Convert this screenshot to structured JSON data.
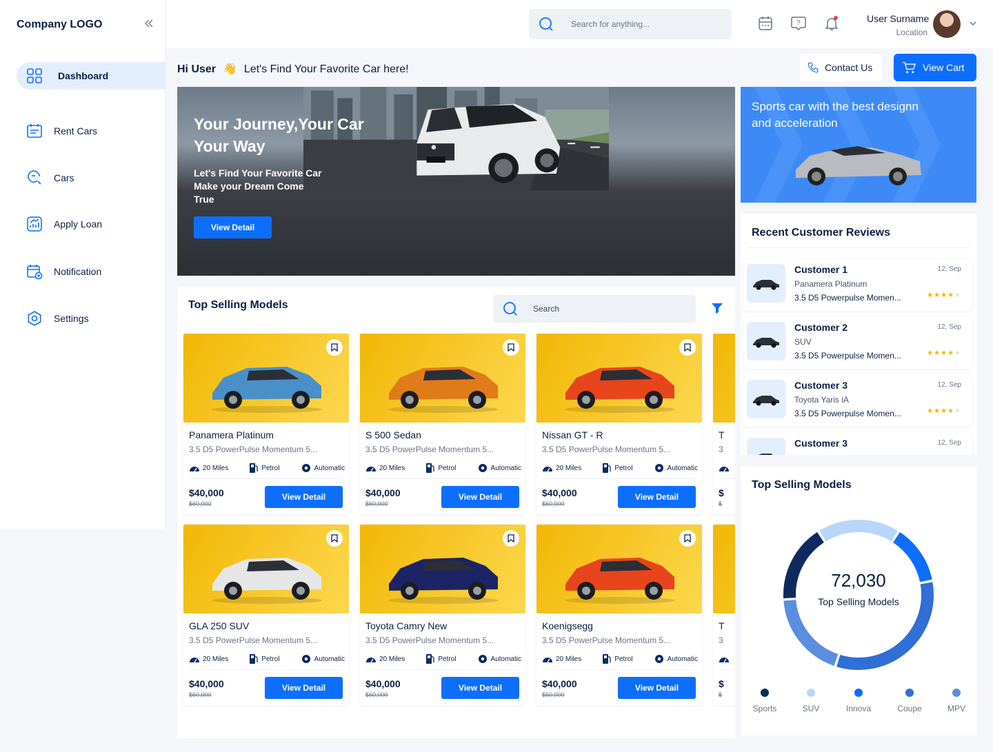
{
  "sidebar": {
    "logo": "Company LOGO",
    "items": [
      {
        "label": "Dashboard"
      },
      {
        "label": "Rent Cars"
      },
      {
        "label": "Cars"
      },
      {
        "label": "Apply Loan"
      },
      {
        "label": "Notification"
      },
      {
        "label": "Settings"
      }
    ]
  },
  "header": {
    "search_placeholder": "Search for anything...",
    "user_name": "User Surname",
    "user_location": "Location"
  },
  "greeting": {
    "hi": "Hi User",
    "emoji": "👋",
    "text": "Let's Find Your Favorite Car here!",
    "contact_label": "Contact Us",
    "cart_label": "View Cart"
  },
  "hero": {
    "title": "Your Journey,Your Car Your Way",
    "subtitle": "Let's Find Your Favorite Car Make your Dream Come True",
    "button": "View Detail"
  },
  "promo": {
    "text": "Sports car with the best designn and acceleration"
  },
  "top_selling": {
    "title": "Top Selling Models",
    "search_placeholder": "Search",
    "cards": [
      {
        "name": "Panamera Platinum",
        "desc": "3.5 D5 PowerPulse Momentum 5...",
        "miles": "20 Miles",
        "fuel": "Petrol",
        "trans": "Automatic",
        "price": "$40,000",
        "old_price": "$60,000",
        "button": "View Detail",
        "car_color": "#4a90c8"
      },
      {
        "name": "S 500 Sedan",
        "desc": "3.5 D5 PowerPulse Momentum 5...",
        "miles": "20 Miles",
        "fuel": "Petrol",
        "trans": "Automatic",
        "price": "$40,000",
        "old_price": "$60,000",
        "button": "View Detail",
        "car_color": "#e07b1a"
      },
      {
        "name": "Nissan GT - R",
        "desc": "3.5 D5 PowerPulse Momentum 5...",
        "miles": "20 Miles",
        "fuel": "Petrol",
        "trans": "Automatic",
        "price": "$40,000",
        "old_price": "$60,000",
        "button": "View Detail",
        "car_color": "#e8451c"
      },
      {
        "name": "T",
        "desc": "3",
        "miles": "",
        "fuel": "",
        "trans": "",
        "price": "$",
        "old_price": "$",
        "button": "",
        "car_color": "#f2b705"
      },
      {
        "name": "GLA 250 SUV",
        "desc": "3.5 D5 PowerPulse Momentum 5...",
        "miles": "20 Miles",
        "fuel": "Petrol",
        "trans": "Automatic",
        "price": "$40,000",
        "old_price": "$60,000",
        "button": "View Detail",
        "car_color": "#e6e6e6"
      },
      {
        "name": "Toyota Camry New",
        "desc": "3.5 D5 PowerPulse Momentum 5...",
        "miles": "20 Miles",
        "fuel": "Petrol",
        "trans": "Automatic",
        "price": "$40,000",
        "old_price": "$60,000",
        "button": "View Detail",
        "car_color": "#1c2466"
      },
      {
        "name": "Koenigsegg",
        "desc": "3.5 D5 PowerPulse Momentum 5...",
        "miles": "20 Miles",
        "fuel": "Petrol",
        "trans": "Automatic",
        "price": "$40,000",
        "old_price": "$60,000",
        "button": "View Detail",
        "car_color": "#e8451c"
      },
      {
        "name": "T",
        "desc": "3",
        "miles": "",
        "fuel": "",
        "trans": "",
        "price": "$",
        "old_price": "$",
        "button": "",
        "car_color": "#f2b705"
      }
    ]
  },
  "reviews": {
    "title": "Recent Customer Reviews",
    "items": [
      {
        "name": "Customer 1",
        "date": "12, Sep",
        "model": "Panamera Platinum",
        "text": "3.5 D5 Powerpulse Momen...",
        "stars": 4
      },
      {
        "name": "Customer 2",
        "date": "12, Sep",
        "model": "SUV",
        "text": "3.5 D5 Powerpulse Momen...",
        "stars": 4
      },
      {
        "name": "Customer 3",
        "date": "12, Sep",
        "model": "Toyota Yaris iA",
        "text": "3.5 D5 Powerpulse Momen...",
        "stars": 4
      },
      {
        "name": "Customer 3",
        "date": "12, Sep",
        "model": "",
        "text": "",
        "stars": 0
      }
    ]
  },
  "donut": {
    "title": "Top Selling Models",
    "value": "72,030",
    "label": "Top Selling Models",
    "segments": [
      {
        "name": "Sports",
        "color": "#0f2a5e",
        "share": 0.17
      },
      {
        "name": "SUV",
        "color": "#b9d5fb",
        "share": 0.18
      },
      {
        "name": "Innova",
        "color": "#0d6efd",
        "share": 0.13
      },
      {
        "name": "Coupe",
        "color": "#2f6fd6",
        "share": 0.33
      },
      {
        "name": "MPV",
        "color": "#5a8fe0",
        "share": 0.19
      }
    ]
  },
  "colors": {
    "primary": "#0d6efd",
    "navy": "#0b1f44",
    "card_yellow": "#f2b705"
  }
}
